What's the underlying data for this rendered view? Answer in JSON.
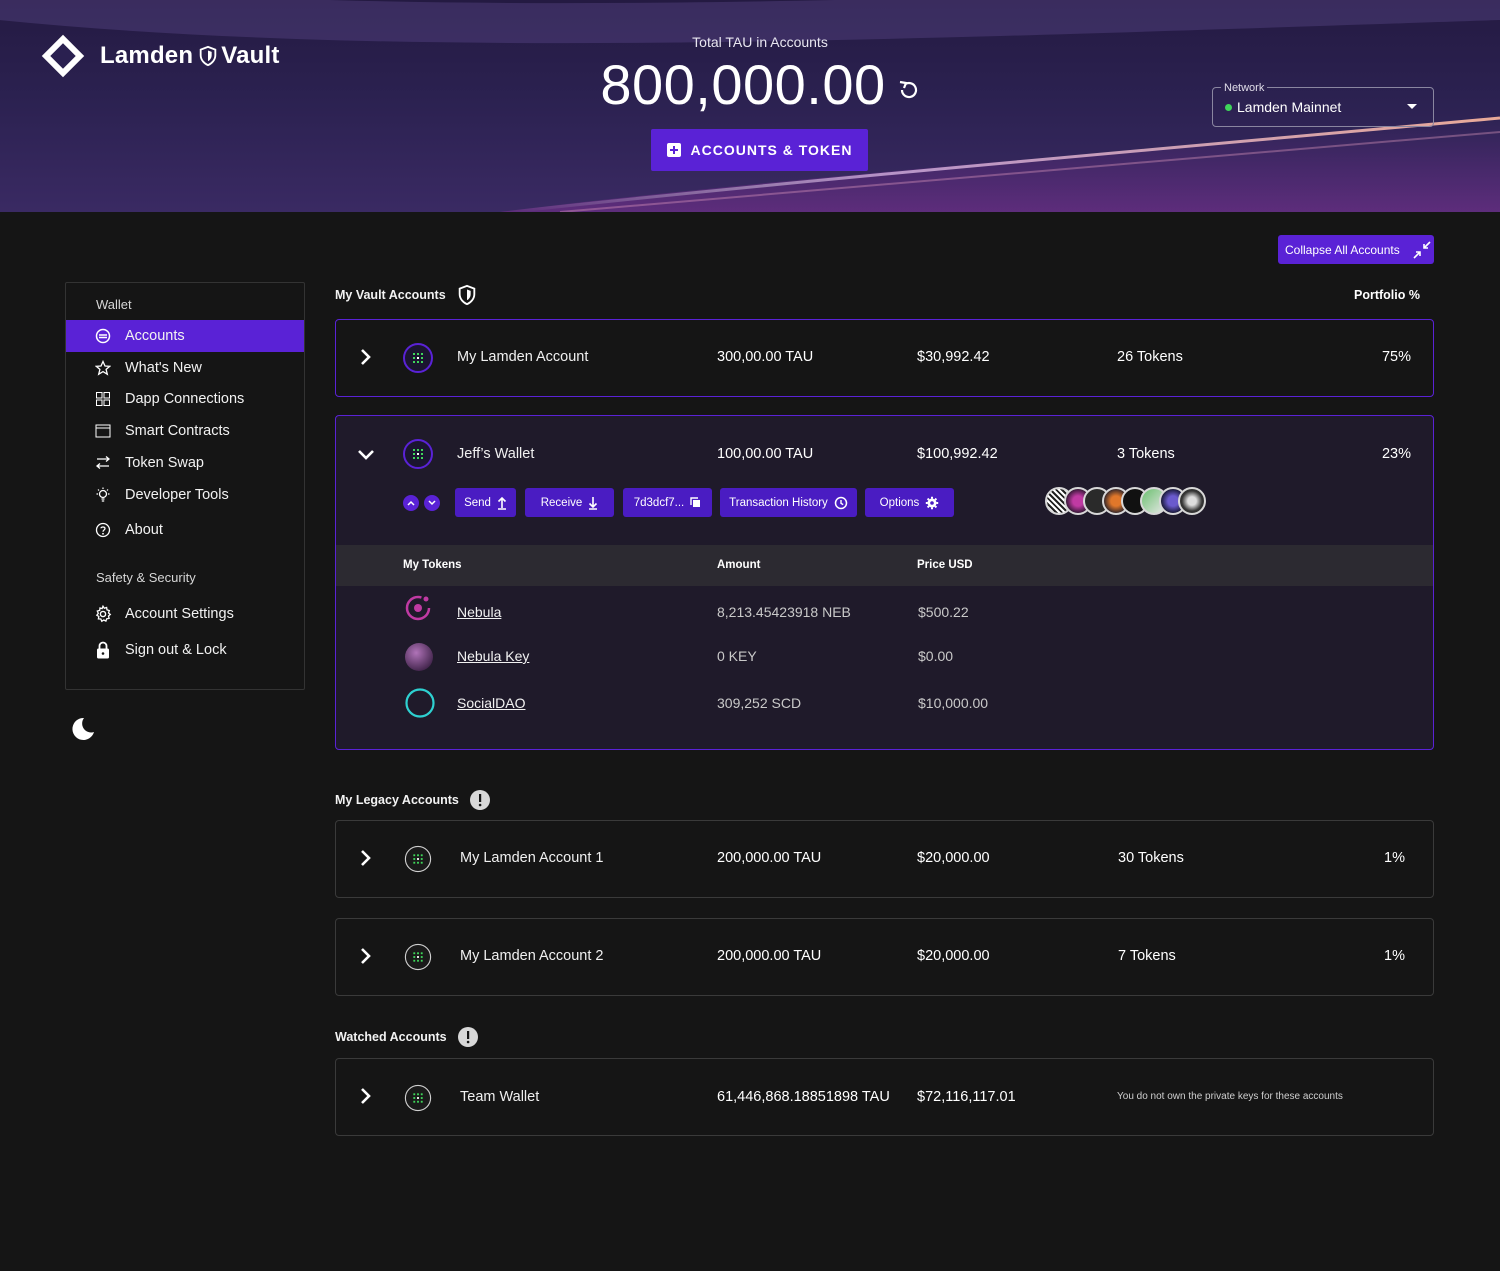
{
  "brand": {
    "name_left": "Lamden",
    "name_right": "Vault"
  },
  "header": {
    "total_caption": "Total TAU in Accounts",
    "total_amount": "800,000.00",
    "add_button": "ACCOUNTS & TOKEN",
    "network": {
      "label": "Network",
      "value": "Lamden Mainnet"
    }
  },
  "collapse_button": "Collapse All Accounts",
  "sidebar": {
    "wallet_heading": "Wallet",
    "items": [
      {
        "label": "Accounts",
        "icon": "accounts-icon"
      },
      {
        "label": "What's New",
        "icon": "star-icon"
      },
      {
        "label": "Dapp Connections",
        "icon": "grid-icon"
      },
      {
        "label": "Smart Contracts",
        "icon": "window-icon"
      },
      {
        "label": "Token Swap",
        "icon": "swap-icon"
      },
      {
        "label": "Developer Tools",
        "icon": "lightbulb-icon"
      },
      {
        "label": "About",
        "icon": "help-icon"
      }
    ],
    "security_heading": "Safety & Security",
    "security_items": [
      {
        "label": "Account Settings",
        "icon": "gear-icon"
      },
      {
        "label": "Sign out & Lock",
        "icon": "lock-icon"
      }
    ]
  },
  "vault": {
    "title": "My Vault Accounts",
    "portfolio_header": "Portfolio %",
    "accounts": [
      {
        "name": "My Lamden Account",
        "tau": "300,00.00 TAU",
        "usd": "$30,992.42",
        "tokens": "26 Tokens",
        "pct": "75%"
      },
      {
        "name": "Jeff’s Wallet",
        "tau": "100,00.00 TAU",
        "usd": "$100,992.42",
        "tokens": "3 Tokens",
        "pct": "23%"
      }
    ],
    "actions": {
      "send": "Send",
      "receive": "Receive",
      "address": "7d3dcf7...",
      "history": "Transaction History",
      "options": "Options"
    },
    "token_table": {
      "headers": [
        "My Tokens",
        "Amount",
        "Price USD"
      ],
      "rows": [
        {
          "name": "Nebula",
          "amount": "8,213.45423918 NEB",
          "price": "$500.22"
        },
        {
          "name": "Nebula Key",
          "amount": "0 KEY",
          "price": "$0.00"
        },
        {
          "name": "SocialDAO",
          "amount": "309,252 SCD",
          "price": "$10,000.00"
        }
      ]
    }
  },
  "legacy": {
    "title": "My Legacy Accounts",
    "accounts": [
      {
        "name": "My Lamden Account 1",
        "tau": "200,000.00 TAU",
        "usd": "$20,000.00",
        "tokens": "30 Tokens",
        "pct": "1%"
      },
      {
        "name": "My Lamden Account 2",
        "tau": "200,000.00 TAU",
        "usd": "$20,000.00",
        "tokens": "7 Tokens",
        "pct": "1%"
      }
    ]
  },
  "watched": {
    "title": "Watched Accounts",
    "accounts": [
      {
        "name": "Team Wallet",
        "tau": "61,446,868.18851898 TAU",
        "usd": "$72,116,117.01",
        "note": "You do not own the private keys for these accounts"
      }
    ]
  },
  "colors": {
    "accent": "#5a22d6",
    "background": "#151515",
    "network_online": "#3fd65a"
  }
}
